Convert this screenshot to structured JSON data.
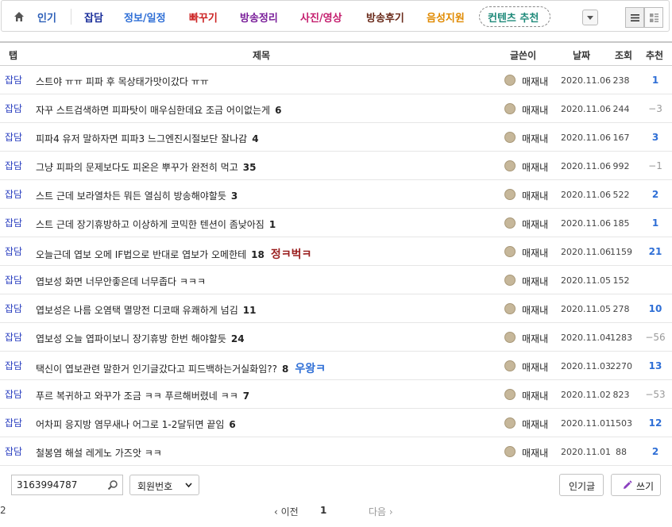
{
  "nav": {
    "tabs": [
      {
        "label": "인기",
        "color": "#2d5fb8"
      },
      {
        "label": "잡담",
        "color": "#1a2e9a"
      },
      {
        "label": "정보/일정",
        "color": "#2f6fd6"
      },
      {
        "label": "빠꾸기",
        "color": "#cc2222"
      },
      {
        "label": "방송정리",
        "color": "#7a1f9a"
      },
      {
        "label": "사진/영상",
        "color": "#c41e6e"
      },
      {
        "label": "방송후기",
        "color": "#6a2b1b"
      },
      {
        "label": "음성지원",
        "color": "#e08a00"
      },
      {
        "label": "컨텐츠 추천",
        "color": "#1f8a7a"
      }
    ]
  },
  "header": {
    "tab": "탭",
    "title": "제목",
    "author": "글쓴이",
    "date": "날짜",
    "views": "조회",
    "rec": "추천"
  },
  "rows": [
    {
      "cat": "잡담",
      "title": "스트야 ㅠㅠ 피파 후 목상태가맛이갔다 ㅠㅠ",
      "comments": "",
      "badge": "",
      "author": "매재내",
      "date": "2020.11.06",
      "views": "238",
      "rec": "1",
      "rec_type": "pos"
    },
    {
      "cat": "잡담",
      "title": "자꾸 스트검색하면 피파탓이 매우심한데요 조금 어이없는게",
      "comments": "6",
      "badge": "",
      "author": "매재내",
      "date": "2020.11.06",
      "views": "244",
      "rec": "−3",
      "rec_type": "neg"
    },
    {
      "cat": "잡담",
      "title": "피파4 유저 말하자면 피파3 느그엔진시절보단 잘나감",
      "comments": "4",
      "badge": "",
      "author": "매재내",
      "date": "2020.11.06",
      "views": "167",
      "rec": "3",
      "rec_type": "pos"
    },
    {
      "cat": "잡담",
      "title": "그냥 피파의 문제보다도 피온은 뿌꾸가 완전히 먹고",
      "comments": "35",
      "badge": "",
      "author": "매재내",
      "date": "2020.11.06",
      "views": "992",
      "rec": "−1",
      "rec_type": "neg"
    },
    {
      "cat": "잡담",
      "title": "스트 근데 보라열차든 뭐든 열심히 방송해야할듯",
      "comments": "3",
      "badge": "",
      "author": "매재내",
      "date": "2020.11.06",
      "views": "522",
      "rec": "2",
      "rec_type": "pos"
    },
    {
      "cat": "잡담",
      "title": "스트 근데 장기휴방하고 이상하게 코믹한 텐션이 좀낮아짐",
      "comments": "1",
      "badge": "",
      "author": "매재내",
      "date": "2020.11.06",
      "views": "185",
      "rec": "1",
      "rec_type": "pos"
    },
    {
      "cat": "잡담",
      "title": "오늘근데 엽보 오메 IF법으로 반대로 엽보가 오메한테",
      "comments": "18",
      "badge": "정ㅋ벅ㅋ",
      "badge_color": "#9a1f1f",
      "author": "매재내",
      "date": "2020.11.06",
      "views": "1159",
      "rec": "21",
      "rec_type": "pos"
    },
    {
      "cat": "잡담",
      "title": "엽보성 화면 너무안좋은데 너무좁다 ㅋㅋㅋ",
      "comments": "",
      "badge": "",
      "author": "매재내",
      "date": "2020.11.05",
      "views": "152",
      "rec": "",
      "rec_type": "pos"
    },
    {
      "cat": "잡담",
      "title": "엽보성은 나름 오염택 멸망전 디코때 유쾌하게 넘김",
      "comments": "11",
      "badge": "",
      "author": "매재내",
      "date": "2020.11.05",
      "views": "278",
      "rec": "10",
      "rec_type": "pos"
    },
    {
      "cat": "잡담",
      "title": "엽보성 오늘 엽파이보니 장기휴방 한번 해야할듯",
      "comments": "24",
      "badge": "",
      "author": "매재내",
      "date": "2020.11.04",
      "views": "1283",
      "rec": "−56",
      "rec_type": "neg"
    },
    {
      "cat": "잡담",
      "title": "택신이 엽보관련 말한거 인기글갔다고 피드백하는거실화임??",
      "comments": "8",
      "badge": "우왕ㅋ",
      "badge_color": "#2f6fd6",
      "author": "매재내",
      "date": "2020.11.03",
      "views": "2270",
      "rec": "13",
      "rec_type": "pos"
    },
    {
      "cat": "잡담",
      "title": "푸르 복귀하고 와꾸가 조금 ㅋㅋ 푸르해버렸네 ㅋㅋ",
      "comments": "7",
      "badge": "",
      "author": "매재내",
      "date": "2020.11.02",
      "views": "823",
      "rec": "−53",
      "rec_type": "neg"
    },
    {
      "cat": "잡담",
      "title": "어차피 응지방 염무새나 어그로 1-2달뒤면 끝임",
      "comments": "6",
      "badge": "",
      "author": "매재내",
      "date": "2020.11.01",
      "views": "1503",
      "rec": "12",
      "rec_type": "pos"
    },
    {
      "cat": "잡담",
      "title": "철봉염 해설 레게노 가즈앗 ㅋㅋ",
      "comments": "",
      "badge": "",
      "author": "매재내",
      "date": "2020.11.01",
      "views": "88",
      "rec": "2",
      "rec_type": "pos"
    }
  ],
  "search": {
    "value": "3163994787"
  },
  "select": {
    "value": "회원번호"
  },
  "buttons": {
    "popular": "인기글",
    "write": "쓰기"
  },
  "pager": {
    "prev": "‹ 이전",
    "p1": "1",
    "p2": "2",
    "next": "다음 ›"
  }
}
